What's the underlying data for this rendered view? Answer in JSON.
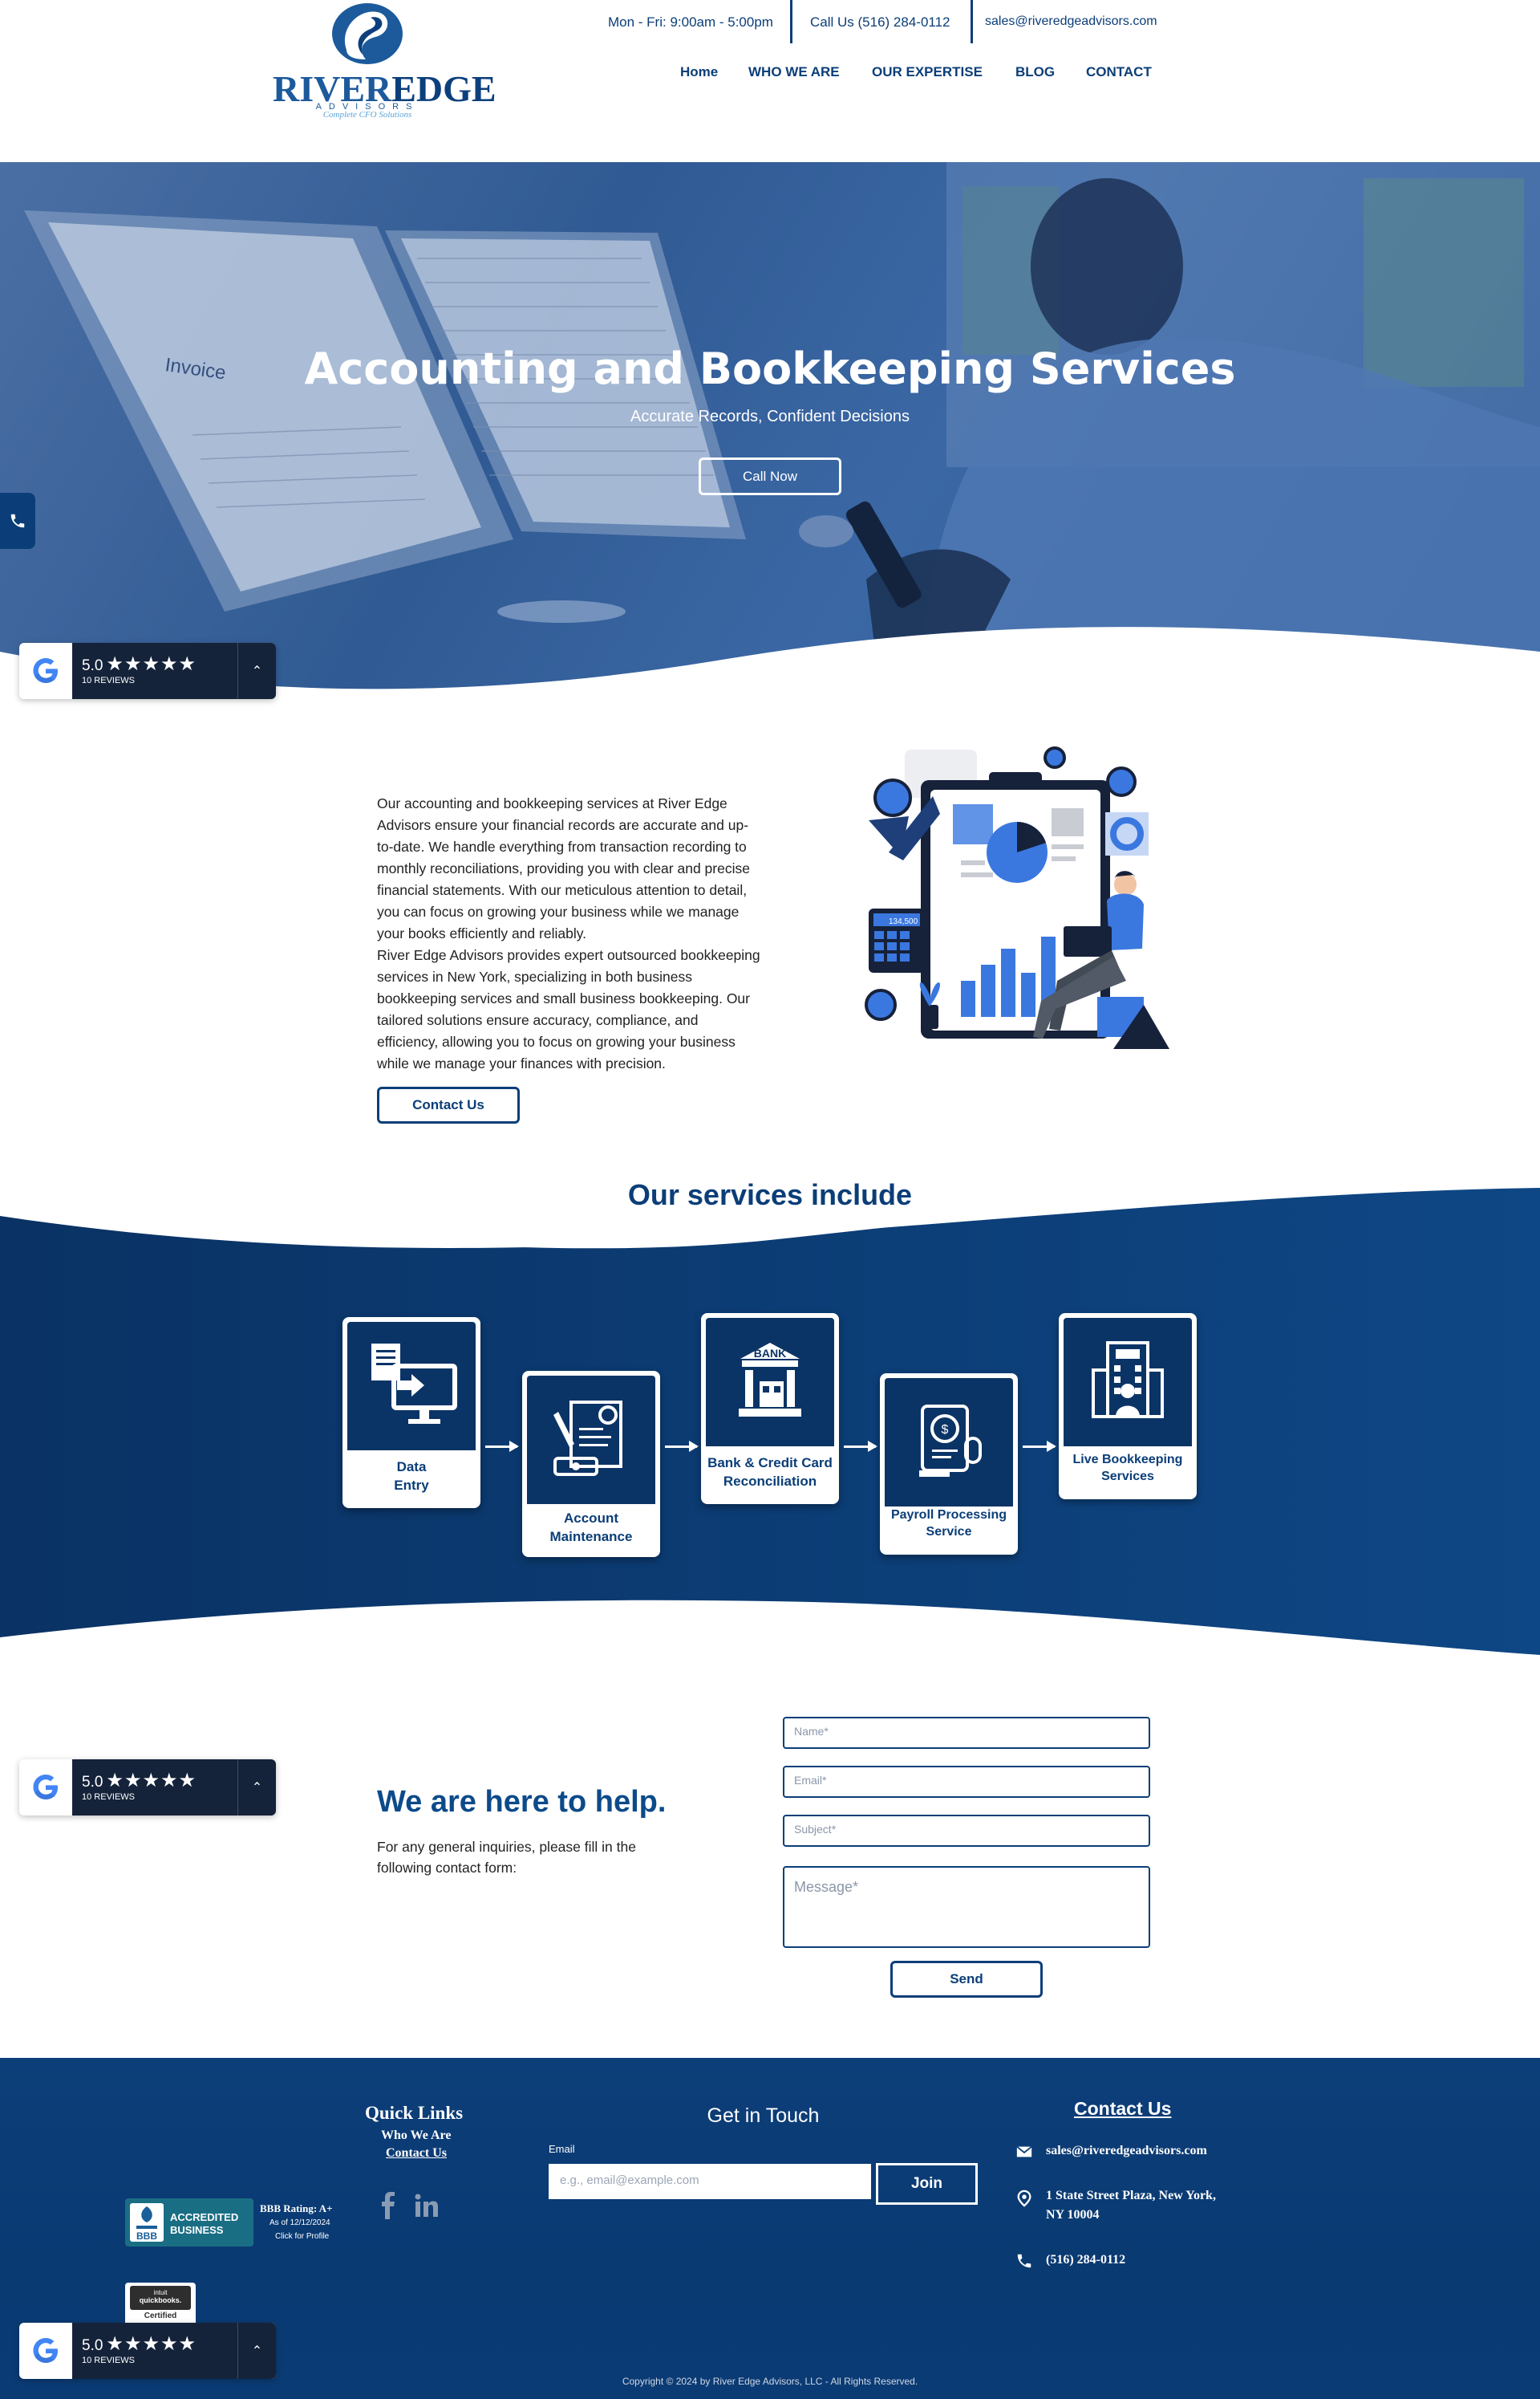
{
  "header": {
    "logo": {
      "river": "RIVER",
      "edge": "EDGE",
      "advisors": "ADVISORS",
      "tagline": "Complete CFO Solutions"
    },
    "hours": "Mon - Fri:  9:00am - 5:00pm",
    "phone": "Call Us (516) 284-0112",
    "email": "sales@riveredgeadvisors.com",
    "nav": [
      "Home",
      "WHO WE ARE",
      "OUR EXPERTISE",
      "BLOG",
      "CONTACT"
    ]
  },
  "hero": {
    "title": "Accounting and Bookkeeping Services",
    "subtitle": "Accurate Records, Confident Decisions",
    "button": "Call Now",
    "image_text": "Invoice"
  },
  "reviews": {
    "score": "5.0",
    "stars": "★★★★★",
    "count": "10 REVIEWS"
  },
  "about": {
    "paragraph1": "Our accounting and bookkeeping services at River Edge Advisors ensure your financial records are accurate and up-to-date. We handle everything from transaction recording to monthly reconciliations, providing you with clear and precise financial statements. With our meticulous attention to detail, you can focus on growing your business while we manage your books efficiently and reliably.",
    "paragraph2": "River Edge Advisors provides expert outsourced bookkeeping services in New York, specializing in both business bookkeeping services and small business bookkeeping. Our tailored solutions ensure accuracy, compliance, and efficiency, allowing you to focus on growing your business while we manage your finances with precision.",
    "button": "Contact Us",
    "illustration_value": "134,500"
  },
  "services": {
    "title": "Our services include",
    "items": [
      {
        "label1": "Data",
        "label2": "Entry",
        "icon": "computer-documents-icon"
      },
      {
        "label1": "Account",
        "label2": "Maintenance",
        "icon": "maintenance-tools-icon"
      },
      {
        "label1": "Bank & Credit Card",
        "label2": "Reconciliation",
        "icon": "bank-icon",
        "icon_text": "BANK"
      },
      {
        "label1": "Payroll Processing",
        "label2": "Service",
        "icon": "payroll-book-icon"
      },
      {
        "label1": "Live Bookkeeping",
        "label2": "Services",
        "icon": "office-building-icon"
      }
    ]
  },
  "contact_form": {
    "title": "We are here to help.",
    "text": "For any general inquiries, please fill in the following contact form:",
    "name_placeholder": "Name*",
    "email_placeholder": "Email*",
    "subject_placeholder": "Subject*",
    "message_placeholder": "Message*",
    "send": "Send"
  },
  "footer": {
    "quick_links_title": "Quick Links",
    "quick_links": [
      "Who We Are",
      "Contact Us"
    ],
    "bbb": {
      "accredited": "ACCREDITED",
      "business": "BUSINESS",
      "bbb": "BBB",
      "rating": "BBB Rating: A+",
      "as_of": "As of 12/12/2024",
      "click": "Click for Profile"
    },
    "qb": {
      "line1": "intuit",
      "line2": "quickbooks.",
      "line3": "Certified"
    },
    "get_in_touch": "Get in Touch",
    "email_label": "Email",
    "email_placeholder": "e.g., email@example.com",
    "join": "Join",
    "contact_title": "Contact Us",
    "contact_email": "sales@riveredgeadvisors.com",
    "address1": "1 State Street Plaza, New York,",
    "address2": "NY 10004",
    "phone": "(516) 284-0112",
    "copyright": "Copyright © 2024 by River Edge Advisors, LLC - All Rights Reserved."
  },
  "colors": {
    "primary": "#0b3e78",
    "dark_navy": "#15233a",
    "accent_blue": "#3a78e0"
  }
}
